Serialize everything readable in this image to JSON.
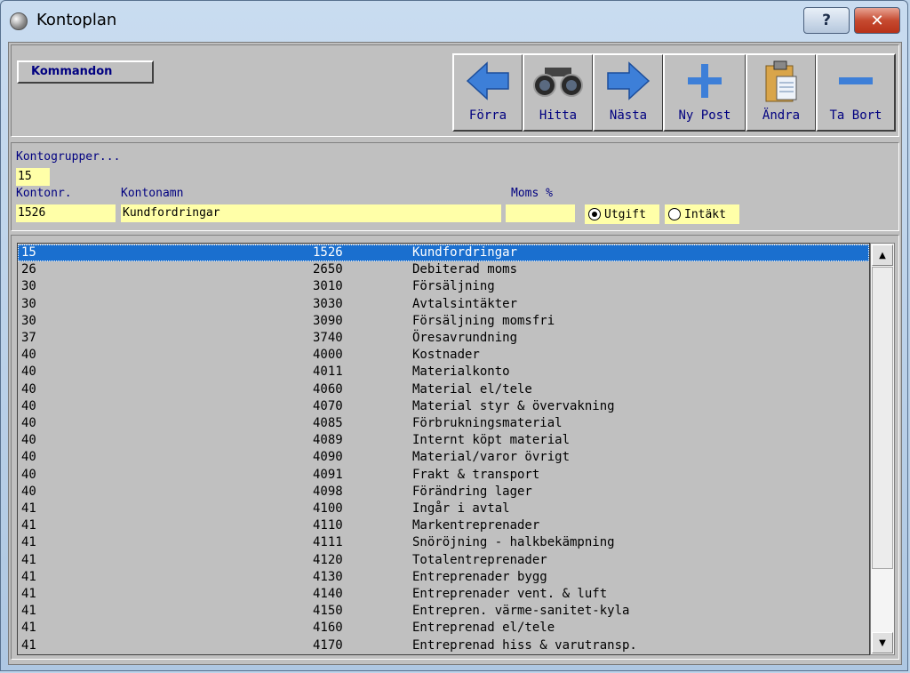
{
  "window": {
    "title": "Kontoplan",
    "help_label": "?",
    "close_label": "✕"
  },
  "toolbar": {
    "kommandon_label": "Kommandon",
    "buttons": [
      {
        "label": "Förra",
        "icon": "arrow-left-icon"
      },
      {
        "label": "Hitta",
        "icon": "binoculars-icon"
      },
      {
        "label": "Nästa",
        "icon": "arrow-right-icon"
      },
      {
        "label": "Ny Post",
        "icon": "plus-icon"
      },
      {
        "label": "Ändra",
        "icon": "clipboard-icon"
      },
      {
        "label": "Ta Bort",
        "icon": "minus-icon"
      }
    ]
  },
  "form": {
    "kontogrupper_label": "Kontogrupper...",
    "kontogrupper_value": "15",
    "kontonr_label": "Kontonr.",
    "kontonr_value": "1526",
    "kontonamn_label": "Kontonamn",
    "kontonamn_value": "Kundfordringar",
    "moms_label": "Moms %",
    "moms_value": "",
    "radio_utgift": "Utgift",
    "radio_intakt": "Intäkt",
    "selected_radio": "Utgift"
  },
  "list": {
    "selected_index": 0,
    "rows": [
      [
        "15",
        "1526",
        "Kundfordringar"
      ],
      [
        "26",
        "2650",
        "Debiterad moms"
      ],
      [
        "30",
        "3010",
        "Försäljning"
      ],
      [
        "30",
        "3030",
        "Avtalsintäkter"
      ],
      [
        "30",
        "3090",
        "Försäljning momsfri"
      ],
      [
        "37",
        "3740",
        "Öresavrundning"
      ],
      [
        "40",
        "4000",
        "Kostnader"
      ],
      [
        "40",
        "4011",
        "Materialkonto"
      ],
      [
        "40",
        "4060",
        "Material el/tele"
      ],
      [
        "40",
        "4070",
        "Material styr & övervakning"
      ],
      [
        "40",
        "4085",
        "Förbrukningsmaterial"
      ],
      [
        "40",
        "4089",
        "Internt köpt material"
      ],
      [
        "40",
        "4090",
        "Material/varor övrigt"
      ],
      [
        "40",
        "4091",
        "Frakt & transport"
      ],
      [
        "40",
        "4098",
        "Förändring lager"
      ],
      [
        "41",
        "4100",
        "Ingår i avtal"
      ],
      [
        "41",
        "4110",
        "Markentreprenader"
      ],
      [
        "41",
        "4111",
        "Snöröjning - halkbekämpning"
      ],
      [
        "41",
        "4120",
        "Totalentreprenader"
      ],
      [
        "41",
        "4130",
        "Entreprenader bygg"
      ],
      [
        "41",
        "4140",
        "Entreprenader vent. & luft"
      ],
      [
        "41",
        "4150",
        "Entrepren. värme-sanitet-kyla"
      ],
      [
        "41",
        "4160",
        "Entreprenad el/tele"
      ],
      [
        "41",
        "4170",
        "Entreprenad hiss & varutransp."
      ]
    ]
  },
  "colors": {
    "selection": "#1a6fcf",
    "field_bg": "#ffffa8",
    "label_text": "#000080"
  }
}
